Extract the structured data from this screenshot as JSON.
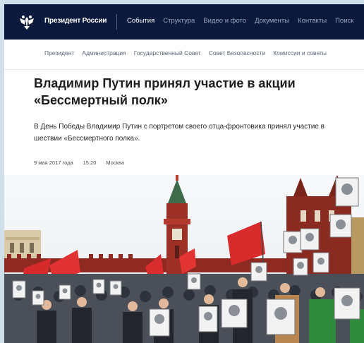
{
  "header": {
    "brand": "Президент России",
    "nav": [
      {
        "label": "События",
        "active": true
      },
      {
        "label": "Структура",
        "active": false
      },
      {
        "label": "Видео и фото",
        "active": false
      },
      {
        "label": "Документы",
        "active": false
      },
      {
        "label": "Контакты",
        "active": false
      },
      {
        "label": "Поиск",
        "active": false
      }
    ]
  },
  "subnav": {
    "items": [
      "Президент",
      "Администрация",
      "Государственный Совет",
      "Совет Безопасности",
      "Комиссии и советы"
    ]
  },
  "article": {
    "title": "Владимир Путин принял участие в акции «Бессмертный полк»",
    "lead": "В День Победы Владимир Путин с портретом своего отца-фронтовика принял участие в шествии «Бессмертного полка».",
    "date": "9 мая 2017 года",
    "time": "15:20",
    "place": "Москва"
  },
  "icons": {
    "emblem": "double-headed-eagle-icon"
  },
  "colors": {
    "header_bg": "#0b1a3c",
    "nav_active": "#ffffff",
    "nav_inactive": "#9aa6c0"
  }
}
